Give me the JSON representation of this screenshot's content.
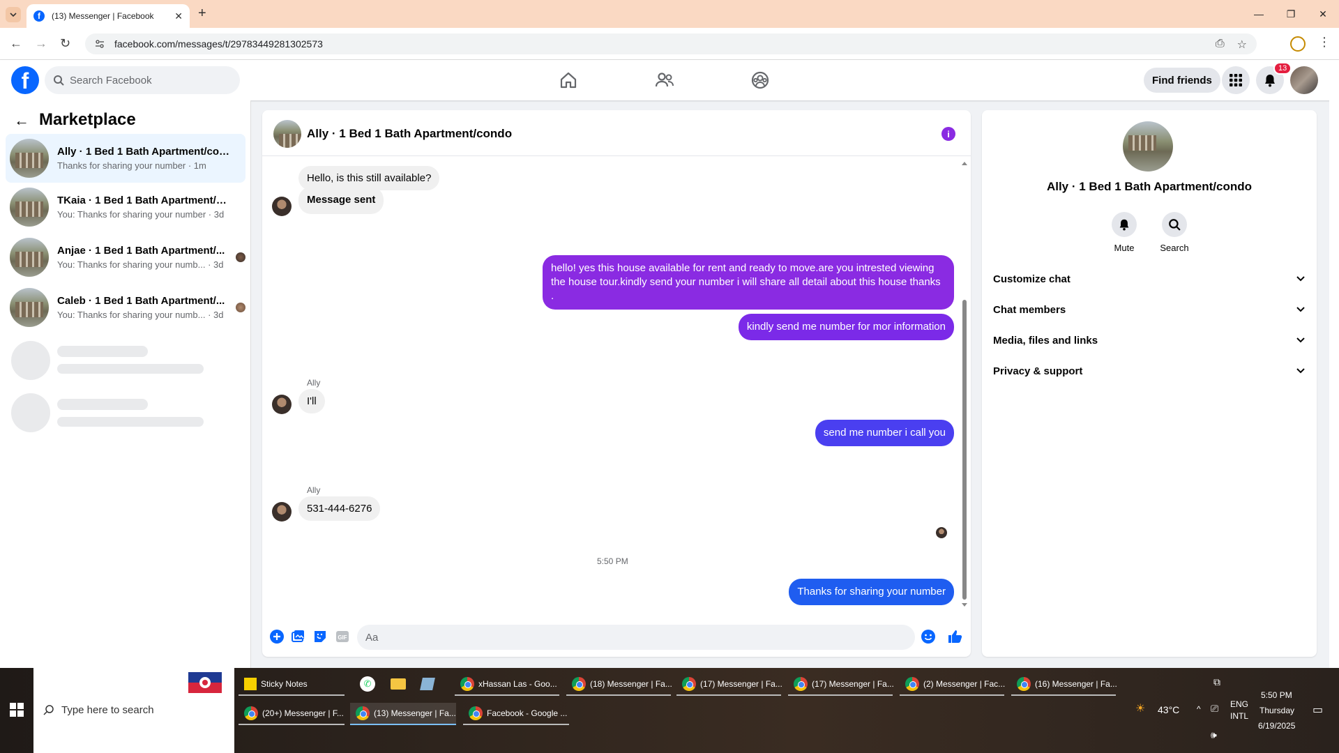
{
  "browser": {
    "tab_title": "(13) Messenger | Facebook",
    "url": "facebook.com/messages/t/29783449281302573"
  },
  "header": {
    "search_placeholder": "Search Facebook",
    "find_friends": "Find friends",
    "notification_count": "13"
  },
  "sidebar": {
    "title": "Marketplace",
    "conversations": [
      {
        "name": "Ally · 1 Bed 1 Bath Apartment/condo",
        "preview": "Thanks for sharing your number · 1m"
      },
      {
        "name": "TKaia · 1 Bed 1 Bath Apartment/co...",
        "preview": "You: Thanks for sharing your number · 3d"
      },
      {
        "name": "Anjae · 1 Bed 1 Bath Apartment/...",
        "preview": "You: Thanks for sharing your numb... · 3d"
      },
      {
        "name": "Caleb · 1 Bed 1 Bath Apartment/...",
        "preview": "You: Thanks for sharing your numb... · 3d"
      }
    ]
  },
  "chat": {
    "title": "Ally · 1 Bed 1 Bath Apartment/condo",
    "messages": [
      {
        "sender": "Ally",
        "text": "Hello, is this still available?"
      },
      {
        "text": "Message sent"
      },
      {
        "text": "hello! yes this house available for rent and ready to move.are you intrested viewing the house tour.kindly send your number i will share all detail about this house thanks ."
      },
      {
        "text": "kindly send me number for mor information"
      },
      {
        "sender": "Ally",
        "text": "I'll"
      },
      {
        "text": "send me number i call you"
      },
      {
        "sender": "Ally",
        "text": "531-444-6276"
      },
      {
        "text": "Thanks for sharing your number"
      }
    ],
    "time_separator": "5:50 PM",
    "composer_placeholder": "Aa"
  },
  "details": {
    "name": "Ally · 1 Bed 1 Bath Apartment/condo",
    "actions": [
      "Mute",
      "Search"
    ],
    "sections": [
      "Customize chat",
      "Chat members",
      "Media, files and links",
      "Privacy & support"
    ]
  },
  "taskbar": {
    "search_placeholder": "Type here to search",
    "apps_row1": [
      "Sticky Notes",
      "xHassan Las - Goo...",
      "(18) Messenger | Fa...",
      "(17) Messenger | Fa...",
      "(17) Messenger | Fa...",
      "(2) Messenger | Fac...",
      "(16) Messenger | Fa..."
    ],
    "apps_row2": [
      "(20+) Messenger | F...",
      "(13) Messenger | Fa...",
      "Facebook - Google ..."
    ],
    "temperature": "43°C",
    "lang1": "ENG",
    "lang2": "INTL",
    "time": "5:50 PM",
    "day": "Thursday",
    "date": "6/19/2025"
  },
  "colors": {
    "purple_bubble": "#8a2be2",
    "indigo_bubble": "#6a2ff0",
    "blue_bubble": "#2f54eb",
    "facebook_blue": "#0866ff"
  }
}
